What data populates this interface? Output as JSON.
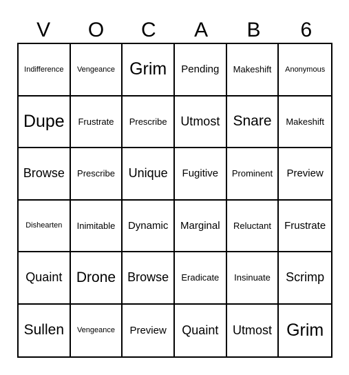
{
  "title_letters": [
    "V",
    "O",
    "C",
    "A",
    "B",
    "6"
  ],
  "cells": [
    [
      {
        "t": "Indifference",
        "s": 1
      },
      {
        "t": "Vengeance",
        "s": 1
      },
      {
        "t": "Grim",
        "s": 6
      },
      {
        "t": "Pending",
        "s": 3
      },
      {
        "t": "Makeshift",
        "s": 2
      },
      {
        "t": "Anonymous",
        "s": 1
      }
    ],
    [
      {
        "t": "Dupe",
        "s": 6
      },
      {
        "t": "Frustrate",
        "s": 2
      },
      {
        "t": "Prescribe",
        "s": 2
      },
      {
        "t": "Utmost",
        "s": 4
      },
      {
        "t": "Snare",
        "s": 5
      },
      {
        "t": "Makeshift",
        "s": 2
      }
    ],
    [
      {
        "t": "Browse",
        "s": 4
      },
      {
        "t": "Prescribe",
        "s": 2
      },
      {
        "t": "Unique",
        "s": 4
      },
      {
        "t": "Fugitive",
        "s": 3
      },
      {
        "t": "Prominent",
        "s": 2
      },
      {
        "t": "Preview",
        "s": 3
      }
    ],
    [
      {
        "t": "Dishearten",
        "s": 1
      },
      {
        "t": "Inimitable",
        "s": 2
      },
      {
        "t": "Dynamic",
        "s": 3
      },
      {
        "t": "Marginal",
        "s": 3
      },
      {
        "t": "Reluctant",
        "s": 2
      },
      {
        "t": "Frustrate",
        "s": 3
      }
    ],
    [
      {
        "t": "Quaint",
        "s": 4
      },
      {
        "t": "Drone",
        "s": 5
      },
      {
        "t": "Browse",
        "s": 4
      },
      {
        "t": "Eradicate",
        "s": 2
      },
      {
        "t": "Insinuate",
        "s": 2
      },
      {
        "t": "Scrimp",
        "s": 4
      }
    ],
    [
      {
        "t": "Sullen",
        "s": 5
      },
      {
        "t": "Vengeance",
        "s": 1
      },
      {
        "t": "Preview",
        "s": 3
      },
      {
        "t": "Quaint",
        "s": 4
      },
      {
        "t": "Utmost",
        "s": 4
      },
      {
        "t": "Grim",
        "s": 6
      }
    ]
  ]
}
